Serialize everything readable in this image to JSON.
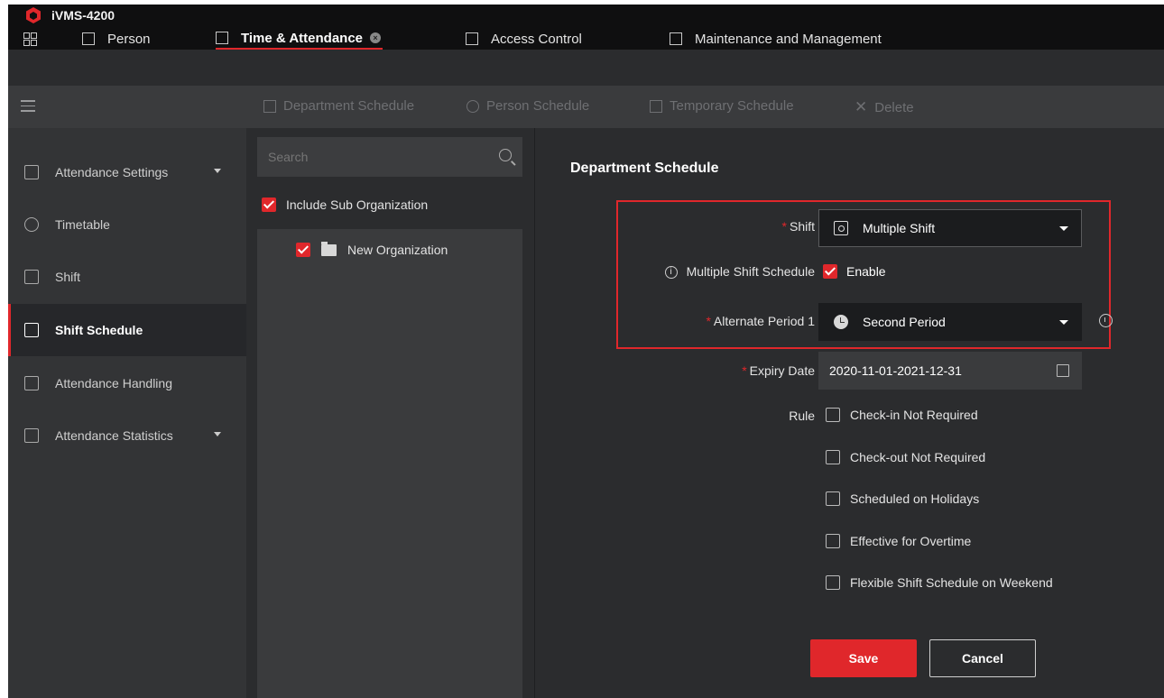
{
  "app": {
    "title": "iVMS-4200"
  },
  "topnav": {
    "person": "Person",
    "time_attendance": "Time & Attendance",
    "access_control": "Access Control",
    "maintenance": "Maintenance and Management"
  },
  "toolbar": {
    "department_schedule": "Department Schedule",
    "person_schedule": "Person Schedule",
    "temporary_schedule": "Temporary Schedule",
    "delete": "Delete"
  },
  "sidebar": {
    "items": [
      {
        "label": "Attendance Settings"
      },
      {
        "label": "Timetable"
      },
      {
        "label": "Shift"
      },
      {
        "label": "Shift Schedule"
      },
      {
        "label": "Attendance Handling"
      },
      {
        "label": "Attendance Statistics"
      }
    ]
  },
  "tree": {
    "search_placeholder": "Search",
    "include_sub": "Include Sub Organization",
    "node": "New Organization"
  },
  "form": {
    "title": "Department Schedule",
    "required_mark": "*",
    "shift_label": "Shift",
    "shift_value": "Multiple Shift",
    "multi_label": "Multiple Shift Schedule",
    "info_glyph": "i",
    "enable": "Enable",
    "alt_label": "Alternate Period 1",
    "alt_value": "Second Period",
    "expiry_label": "Expiry Date",
    "expiry_value": "2020-11-01-2021-12-31",
    "rule_label": "Rule",
    "rules": [
      "Check-in Not Required",
      "Check-out Not Required",
      "Scheduled on Holidays",
      "Effective for Overtime",
      "Flexible Shift Schedule on Weekend"
    ],
    "save": "Save",
    "cancel": "Cancel"
  },
  "colors": {
    "accent": "#e0272b",
    "bg": "#2b2c2e"
  }
}
